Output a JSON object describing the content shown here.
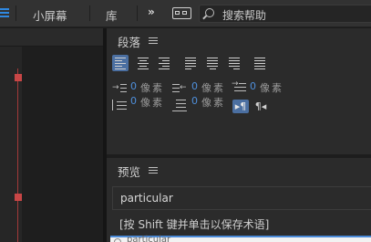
{
  "topbar": {
    "menu_icon": "hamburger-icon",
    "tab_small_screen": "小屏幕",
    "tab_library": "库",
    "more_icon": "chevrons-right-icon",
    "more_glyph": "»",
    "workspace_icon": "workspace-switch-icon",
    "search_placeholder": "搜索帮助",
    "search_icon": "search-icon"
  },
  "paragraph_panel": {
    "title": "段落",
    "menu_icon": "panel-menu-icon",
    "alignment_buttons": [
      {
        "name": "align-left",
        "active": true
      },
      {
        "name": "align-center",
        "active": false
      },
      {
        "name": "align-right",
        "active": false
      },
      {
        "name": "justify-last-left",
        "active": false
      },
      {
        "name": "justify-last-center",
        "active": false
      },
      {
        "name": "justify-last-right",
        "active": false
      },
      {
        "name": "justify-all",
        "active": false
      }
    ],
    "left_indent": {
      "value": "0",
      "unit": "像素"
    },
    "right_indent": {
      "value": "0",
      "unit": "像素"
    },
    "first_line_indent": {
      "value": "0",
      "unit": "像素"
    },
    "space_before": {
      "value": "0",
      "unit": "像素"
    },
    "space_after": {
      "value": "0",
      "unit": "像素"
    },
    "text_direction": {
      "rtl_glyph": "▸¶",
      "ltr_glyph": "¶◂",
      "active": "rtl"
    },
    "accent_color": "#4b6fa1",
    "value_color": "#4f8fdb"
  },
  "preview_panel": {
    "title": "预览",
    "menu_icon": "panel-menu-icon",
    "preview_text": "particular",
    "hint": "[按 Shift 键并单击以保存术语]",
    "input_placeholder": "particular"
  },
  "left_panel": {
    "marker_color": "#c84646"
  }
}
